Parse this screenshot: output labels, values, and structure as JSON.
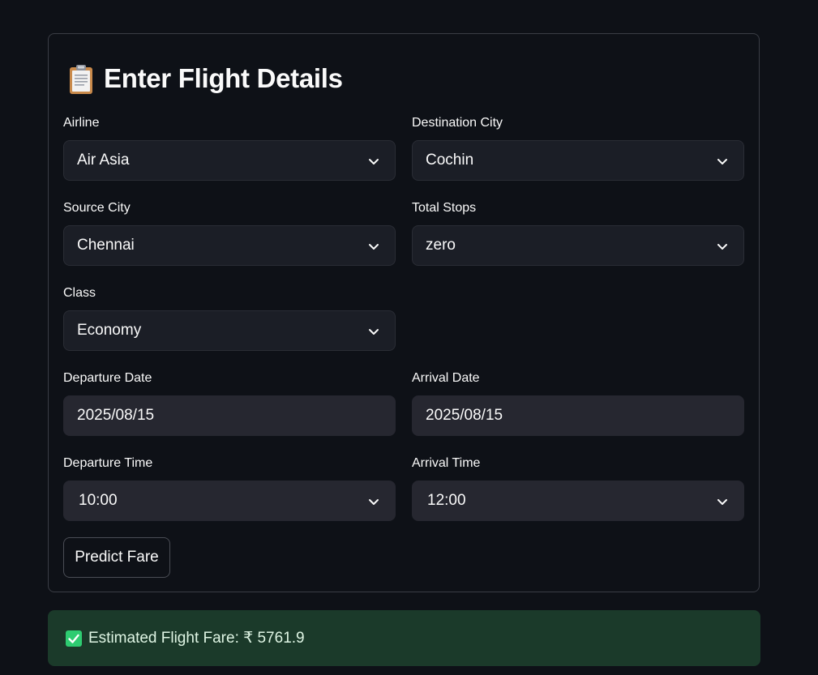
{
  "form": {
    "title": "Enter Flight Details",
    "title_icon": "clipboard-icon",
    "fields": {
      "airline": {
        "label": "Airline",
        "value": "Air Asia"
      },
      "destination_city": {
        "label": "Destination City",
        "value": "Cochin"
      },
      "source_city": {
        "label": "Source City",
        "value": "Chennai"
      },
      "total_stops": {
        "label": "Total Stops",
        "value": "zero"
      },
      "class": {
        "label": "Class",
        "value": "Economy"
      },
      "departure_date": {
        "label": "Departure Date",
        "value": "2025/08/15"
      },
      "arrival_date": {
        "label": "Arrival Date",
        "value": "2025/08/15"
      },
      "departure_time": {
        "label": "Departure Time",
        "value": "10:00"
      },
      "arrival_time": {
        "label": "Arrival Time",
        "value": "12:00"
      }
    },
    "predict_button_label": "Predict Fare"
  },
  "result": {
    "icon": "check-icon",
    "text": "Estimated Flight Fare: ₹ 5761.9"
  },
  "colors": {
    "background": "#0e1117",
    "input_background": "#1b1e26",
    "date_background": "#262730",
    "success_background": "#1b3a2a",
    "check_green": "#2ecc71"
  }
}
